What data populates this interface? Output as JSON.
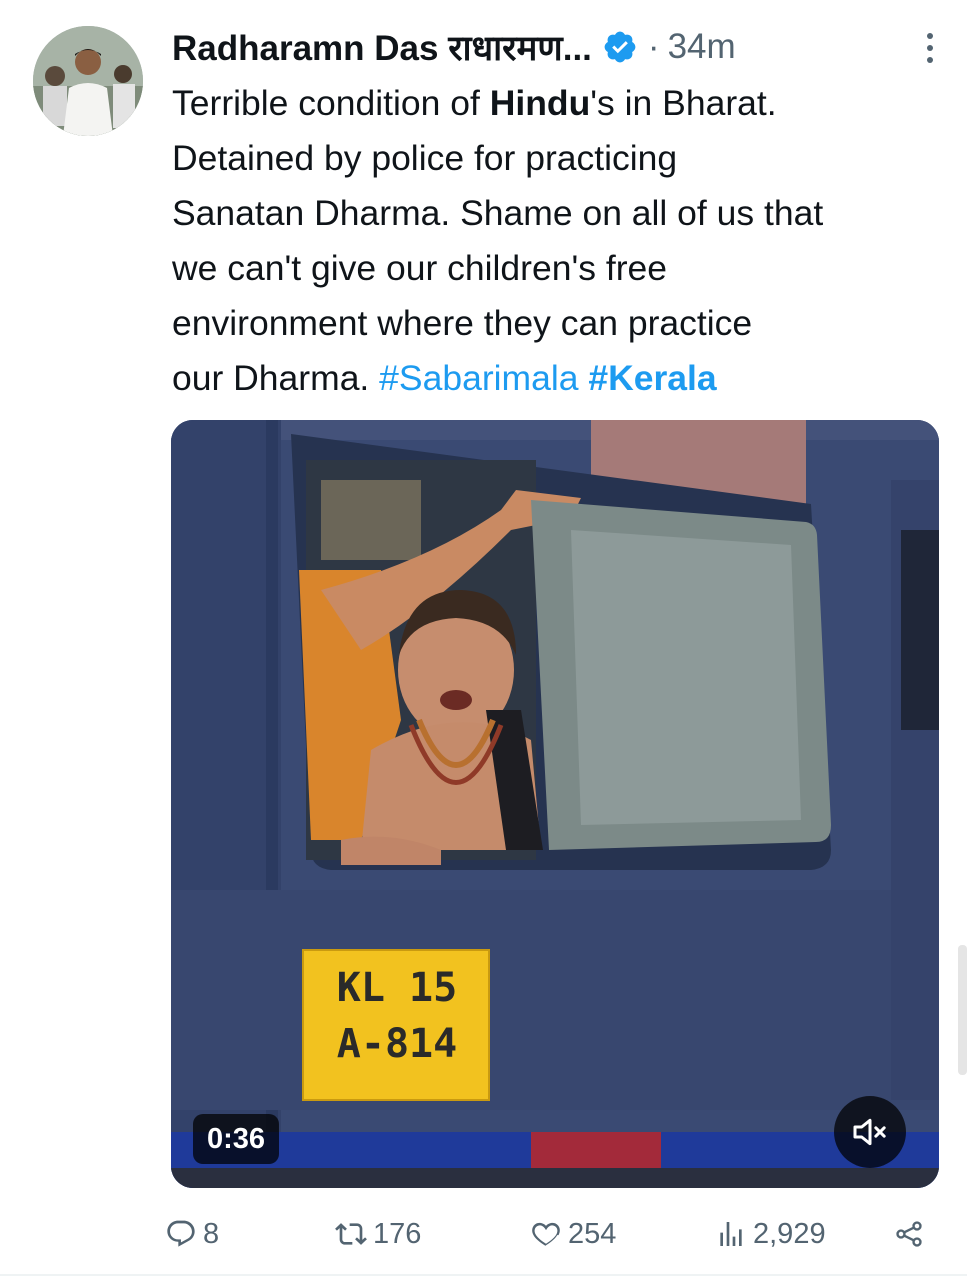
{
  "tweet": {
    "author_name": "Radharamn Das राधारमण...",
    "separator": "·",
    "time": "34m",
    "text_lines": [
      [
        {
          "t": "Terrible condition of "
        },
        {
          "t": "Hindu",
          "style": "bold"
        },
        {
          "t": "'s in Bharat."
        }
      ],
      [
        {
          "t": "Detained by police for practicing"
        }
      ],
      [
        {
          "t": "Sanatan Dharma. Shame on all of us that"
        }
      ],
      [
        {
          "t": "we can't give our children's free"
        }
      ],
      [
        {
          "t": "environment where they can practice"
        }
      ],
      [
        {
          "t": "our Dharma. "
        },
        {
          "t": "#Sabarimala",
          "style": "tag"
        },
        {
          "t": " "
        },
        {
          "t": "#Kerala",
          "style": "tag-bold"
        }
      ]
    ]
  },
  "media": {
    "plate_line1": "KL 15",
    "plate_line2": "A-814",
    "duration": "0:36"
  },
  "actions": {
    "replies": "8",
    "reposts": "176",
    "likes": "254",
    "views": "2,929"
  },
  "icons": {
    "verified": "verified-badge-icon",
    "more": "more-vertical-icon",
    "reply": "reply-icon",
    "repost": "repost-icon",
    "like": "heart-icon",
    "views": "views-icon",
    "share": "share-icon",
    "mute": "muted-speaker-icon"
  },
  "colors": {
    "accent": "#1d9bf0",
    "muted_text": "#536471",
    "text": "#0f1419"
  }
}
